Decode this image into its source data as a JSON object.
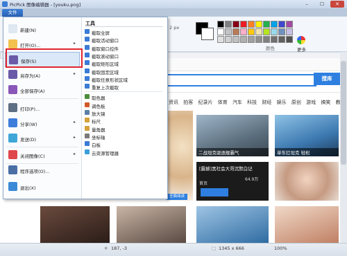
{
  "window": {
    "title": "PicPick 图像编辑器 - [youku.png]",
    "controls": {
      "minimize": "–",
      "maximize": "☐",
      "close": "✕"
    }
  },
  "filetab": {
    "label": "文件"
  },
  "ribbon": {
    "px_value": "2 px",
    "color_group_label": "颜色",
    "more_label": "更多",
    "current_color": "#000000",
    "palette": [
      "#000000",
      "#7f7f7f",
      "#880015",
      "#ed1c24",
      "#ff7f27",
      "#fff200",
      "#22b14c",
      "#00a2e8",
      "#3f48cc",
      "#a349a4",
      "#ffffff",
      "#c3c3c3",
      "#b97a57",
      "#ffaec9",
      "#ffc90e",
      "#efe4b0",
      "#b5e61d",
      "#99d9ea",
      "#7092be",
      "#c8bfe7",
      "#e0e0e0",
      "#d0d0d0",
      "#c0c0c0",
      "#b0b0b0",
      "#a0a0a0",
      "#909090",
      "#808080",
      "#707070",
      "#606060",
      "#505050"
    ]
  },
  "browser": {
    "search_button": "搜库",
    "nav": [
      "资讯",
      "拍客",
      "纪录片",
      "体育",
      "汽车",
      "科技",
      "财经",
      "娱乐",
      "原创",
      "游戏",
      "搞笑",
      "教育"
    ],
    "thumbs": [
      {
        "caption": "二战坦克驱逐舰霸气"
      },
      {
        "caption": "单车扛坦克 轻松"
      },
      {
        "caption": "[震撼]黑社会大哥沉默白记",
        "sub": "首页",
        "time": "64.9万"
      },
      {
        "caption": ""
      }
    ],
    "stripe_label": "全面阅读"
  },
  "statusbar": {
    "cursor": "187, -3",
    "size": "1345 x 666",
    "zoom": "100%"
  },
  "filemenu": {
    "items": [
      {
        "label": "新建(N)",
        "icon": "new-file-icon",
        "color": "#dfe7f1",
        "arrow": ""
      },
      {
        "label": "打开(O)...",
        "icon": "open-folder-icon",
        "color": "#f2c14e",
        "arrow": "▸"
      },
      {
        "label": "保存(S)",
        "icon": "save-disk-icon",
        "color": "#6a5aa8",
        "arrow": ""
      },
      {
        "label": "另存为(A)",
        "icon": "save-as-icon",
        "color": "#6a5aa8",
        "arrow": "▸"
      },
      {
        "label": "全部保存(A)",
        "icon": "save-all-icon",
        "color": "#8a58b8",
        "arrow": ""
      },
      {
        "label": "打印(P)...",
        "icon": "printer-icon",
        "color": "#5f6f84",
        "arrow": ""
      },
      {
        "label": "分享(W)",
        "icon": "share-icon",
        "color": "#3d7edb",
        "arrow": "▸"
      },
      {
        "label": "发送(D)",
        "icon": "send-icon",
        "color": "#3fa7d8",
        "arrow": "▸"
      },
      {
        "label": "关闭图像(C)",
        "icon": "close-image-icon",
        "color": "#e0474c",
        "arrow": "▸"
      },
      {
        "label": "程序选项(O)...",
        "icon": "options-gear-icon",
        "color": "#4a6fa5",
        "arrow": ""
      },
      {
        "label": "退出(X)",
        "icon": "exit-icon",
        "color": "#3b8ad8",
        "arrow": ""
      }
    ],
    "tools_header": "工具",
    "tools": [
      {
        "label": "截取全屏",
        "icon": "fullscreen-capture-icon",
        "color": "#3a7bd5"
      },
      {
        "label": "截取活动窗口",
        "icon": "active-window-capture-icon",
        "color": "#3a7bd5"
      },
      {
        "label": "截取窗口控件",
        "icon": "window-control-capture-icon",
        "color": "#3a7bd5"
      },
      {
        "label": "截取滚动窗口",
        "icon": "scroll-window-capture-icon",
        "color": "#3a7bd5"
      },
      {
        "label": "截取矩形区域",
        "icon": "rect-capture-icon",
        "color": "#3a7bd5"
      },
      {
        "label": "截取固定区域",
        "icon": "fixed-region-capture-icon",
        "color": "#3a7bd5"
      },
      {
        "label": "截取任意形状区域",
        "icon": "freehand-capture-icon",
        "color": "#3a7bd5"
      },
      {
        "label": "重复上次截取",
        "icon": "repeat-capture-icon",
        "color": "#3a7bd5"
      },
      {
        "label": "取色器",
        "icon": "color-picker-icon",
        "color": "#4b8e3a"
      },
      {
        "label": "调色板",
        "icon": "palette-icon",
        "color": "#d05a2a"
      },
      {
        "label": "放大镜",
        "icon": "magnifier-icon",
        "color": "#5d7fa8"
      },
      {
        "label": "标尺",
        "icon": "ruler-icon",
        "color": "#d4a13a"
      },
      {
        "label": "量角器",
        "icon": "protractor-icon",
        "color": "#d4a13a"
      },
      {
        "label": "坐标轴",
        "icon": "crosshair-icon",
        "color": "#7a7a7a"
      },
      {
        "label": "白板",
        "icon": "whiteboard-icon",
        "color": "#3a7bd5"
      },
      {
        "label": "云资源管理器",
        "icon": "cloud-explorer-icon",
        "color": "#3aa0d8"
      }
    ]
  }
}
